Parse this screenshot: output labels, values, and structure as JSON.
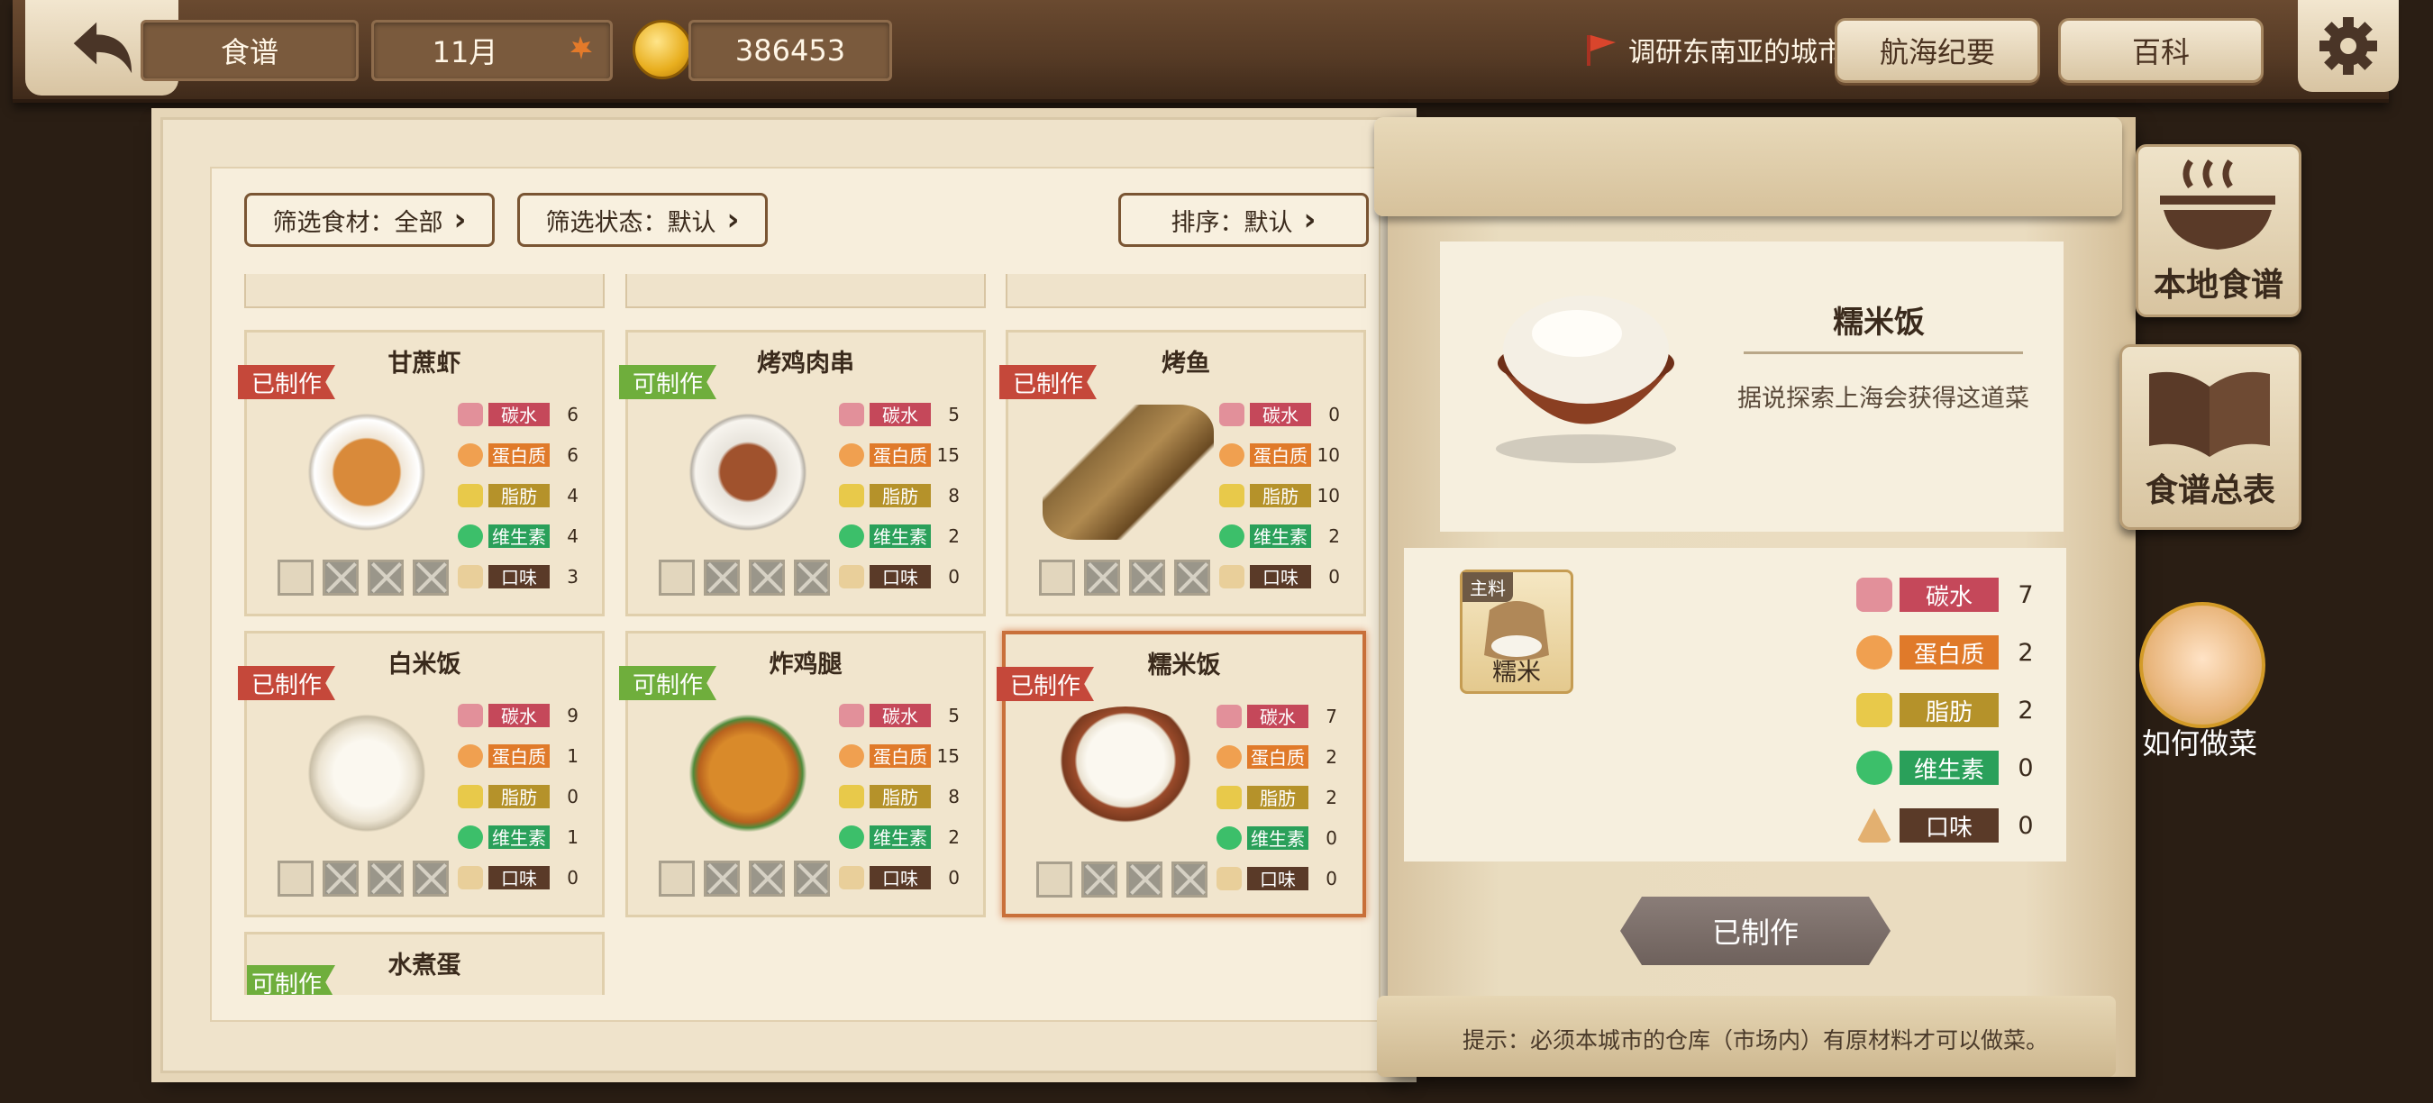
{
  "topbar": {
    "section_label": "食谱",
    "month": "11月",
    "coins": "386453",
    "quest_text": "调研东南亚的城市",
    "btn_voyage": "航海纪要",
    "btn_wiki": "百科"
  },
  "filters": {
    "ingredient": "筛选食材：全部",
    "state": "筛选状态：默认",
    "sort": "排序：默认"
  },
  "recipes": [
    {
      "name": "甘蔗虾",
      "status": "已制作",
      "carb": "6",
      "protein": "6",
      "fat": "4",
      "vitamin": "4",
      "taste": "3"
    },
    {
      "name": "烤鸡肉串",
      "status": "可制作",
      "carb": "5",
      "protein": "15",
      "fat": "8",
      "vitamin": "2",
      "taste": "0"
    },
    {
      "name": "烤鱼",
      "status": "已制作",
      "carb": "0",
      "protein": "10",
      "fat": "10",
      "vitamin": "2",
      "taste": "0"
    },
    {
      "name": "白米饭",
      "status": "已制作",
      "carb": "9",
      "protein": "1",
      "fat": "0",
      "vitamin": "1",
      "taste": "0"
    },
    {
      "name": "炸鸡腿",
      "status": "可制作",
      "carb": "5",
      "protein": "15",
      "fat": "8",
      "vitamin": "2",
      "taste": "0"
    },
    {
      "name": "糯米饭",
      "status": "已制作",
      "carb": "7",
      "protein": "2",
      "fat": "2",
      "vitamin": "0",
      "taste": "0"
    },
    {
      "name": "水煮蛋",
      "status": "可制作"
    }
  ],
  "stat_labels": {
    "carb": "碳水",
    "protein": "蛋白质",
    "fat": "脂肪",
    "vitamin": "维生素",
    "taste": "口味"
  },
  "detail": {
    "name": "糯米饭",
    "desc": "据说探索上海会获得这道菜",
    "ingredient_tag": "主料",
    "ingredient_name": "糯米",
    "carb": "7",
    "protein": "2",
    "fat": "2",
    "vitamin": "0",
    "taste": "0",
    "action": "已制作",
    "hint": "提示：必须本城市的仓库（市场内）有原材料才可以做菜。"
  },
  "side": {
    "local_recipes": "本地食谱",
    "recipe_list": "食谱总表",
    "how_to_cook": "如何做菜"
  },
  "colors": {
    "carb": "#c5485a",
    "protein": "#e07a2a",
    "fat": "#b5922a",
    "vitamin": "#2aa05a",
    "taste": "#5a3a28",
    "made": "#c5483a",
    "can": "#6fae3c"
  }
}
